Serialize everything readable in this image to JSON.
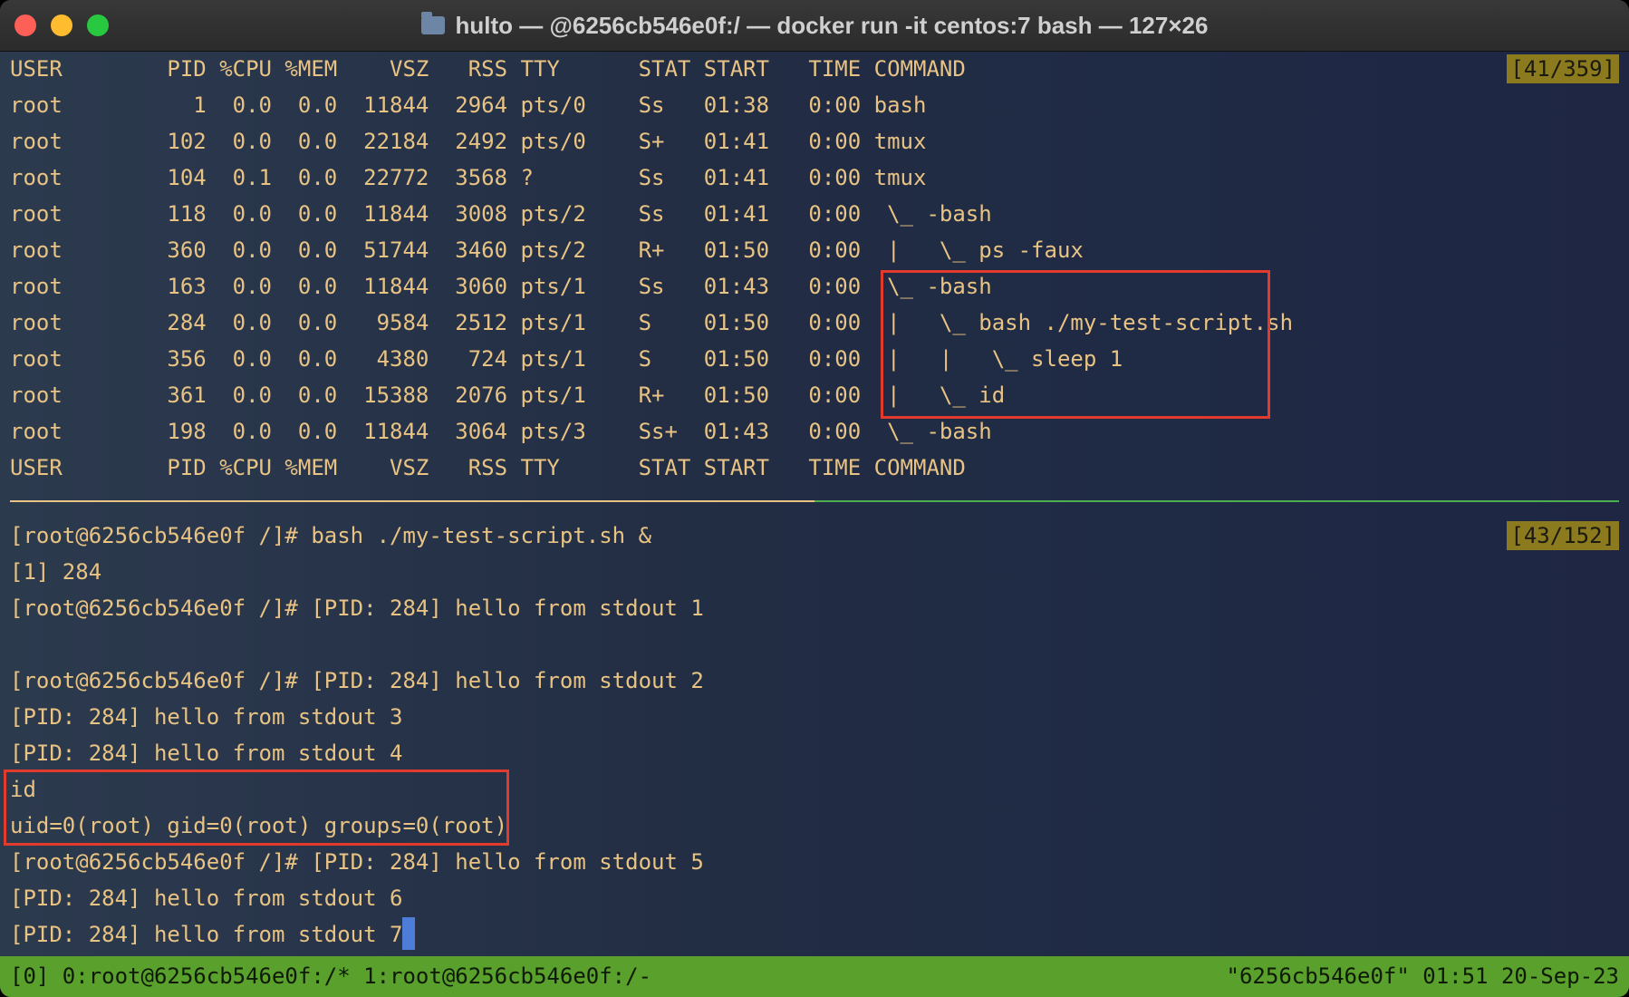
{
  "window": {
    "title": "hulto — @6256cb546e0f:/ — docker run -it centos:7 bash — 127×26"
  },
  "top_pane": {
    "counter": "[41/359]",
    "lines": [
      "USER        PID %CPU %MEM    VSZ   RSS TTY      STAT START   TIME COMMAND",
      "root          1  0.0  0.0  11844  2964 pts/0    Ss   01:38   0:00 bash",
      "root        102  0.0  0.0  22184  2492 pts/0    S+   01:41   0:00 tmux",
      "root        104  0.1  0.0  22772  3568 ?        Ss   01:41   0:00 tmux",
      "root        118  0.0  0.0  11844  3008 pts/2    Ss   01:41   0:00  \\_ -bash",
      "root        360  0.0  0.0  51744  3460 pts/2    R+   01:50   0:00  |   \\_ ps -faux",
      "root        163  0.0  0.0  11844  3060 pts/1    Ss   01:43   0:00  \\_ -bash",
      "root        284  0.0  0.0   9584  2512 pts/1    S    01:50   0:00  |   \\_ bash ./my-test-script.sh",
      "root        356  0.0  0.0   4380   724 pts/1    S    01:50   0:00  |   |   \\_ sleep 1",
      "root        361  0.0  0.0  15388  2076 pts/1    R+   01:50   0:00  |   \\_ id",
      "root        198  0.0  0.0  11844  3064 pts/3    Ss+  01:43   0:00  \\_ -bash",
      "USER        PID %CPU %MEM    VSZ   RSS TTY      STAT START   TIME COMMAND"
    ]
  },
  "bottom_pane": {
    "counter": "[43/152]",
    "lines": [
      "[root@6256cb546e0f /]# bash ./my-test-script.sh &",
      "[1] 284",
      "[root@6256cb546e0f /]# [PID: 284] hello from stdout 1",
      "",
      "[root@6256cb546e0f /]# [PID: 284] hello from stdout 2",
      "[PID: 284] hello from stdout 3",
      "[PID: 284] hello from stdout 4",
      "id",
      "uid=0(root) gid=0(root) groups=0(root)",
      "[root@6256cb546e0f /]# [PID: 284] hello from stdout 5",
      "[PID: 284] hello from stdout 6",
      "[PID: 284] hello from stdout 7"
    ]
  },
  "statusbar": {
    "left": "[0] 0:root@6256cb546e0f:/* 1:root@6256cb546e0f:/-",
    "right": "\"6256cb546e0f\" 01:51 20-Sep-23"
  },
  "colors": {
    "text": "#e8c383",
    "highlight_box": "#e23b2e",
    "statusbar": "#5aa02c",
    "cursor": "#4e7dd8"
  }
}
